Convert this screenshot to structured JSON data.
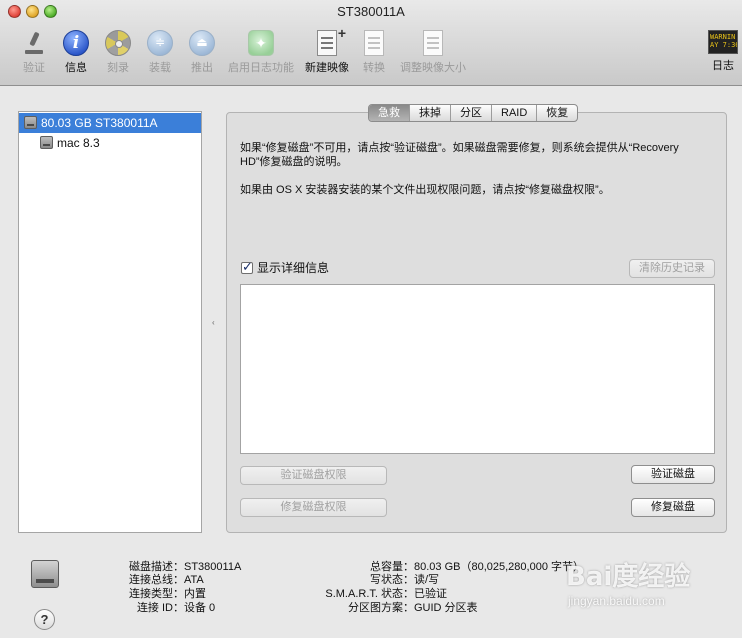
{
  "window": {
    "title": "ST380011A"
  },
  "toolbar": {
    "verify": "验证",
    "info": "信息",
    "burn": "刻录",
    "mount": "装载",
    "eject": "推出",
    "enable_journaling": "启用日志功能",
    "new_image": "新建映像",
    "convert": "转换",
    "resize_image": "调整映像大小",
    "log": "日志",
    "log_icon_text": "WARNIN\nAY 7:36"
  },
  "sidebar": {
    "items": [
      {
        "label": "80.03 GB ST380011A",
        "selected": true
      },
      {
        "label": "mac 8.3",
        "selected": false
      }
    ]
  },
  "tabs": [
    "急救",
    "抹掉",
    "分区",
    "RAID",
    "恢复"
  ],
  "active_tab": "急救",
  "first_aid": {
    "text1": "如果“修复磁盘”不可用，请点按“验证磁盘”。如果磁盘需要修复，则系统会提供从“Recovery HD”修复磁盘的说明。",
    "text2": "如果由 OS X 安装器安装的某个文件出现权限问题，请点按“修复磁盘权限”。",
    "show_details": "显示详细信息",
    "show_details_checked": true,
    "clear_history": "清除历史记录",
    "verify_permissions": "验证磁盘权限",
    "repair_permissions": "修复磁盘权限",
    "verify_disk": "验证磁盘",
    "repair_disk": "修复磁盘"
  },
  "info": {
    "left": [
      {
        "k": "磁盘描述：",
        "v": "ST380011A"
      },
      {
        "k": "连接总线：",
        "v": "ATA"
      },
      {
        "k": "连接类型：",
        "v": "内置"
      },
      {
        "k": "连接 ID：",
        "v": "设备 0"
      }
    ],
    "right": [
      {
        "k": "总容量：",
        "v": "80.03 GB（80,025,280,000 字节）"
      },
      {
        "k": "写状态：",
        "v": "读/写"
      },
      {
        "k": "S.M.A.R.T. 状态：",
        "v": "已验证"
      },
      {
        "k": "分区图方案：",
        "v": "GUID 分区表"
      }
    ]
  },
  "help": "?",
  "watermark": {
    "brand": "Bai度经验",
    "url": "jingyan.baidu.com"
  }
}
